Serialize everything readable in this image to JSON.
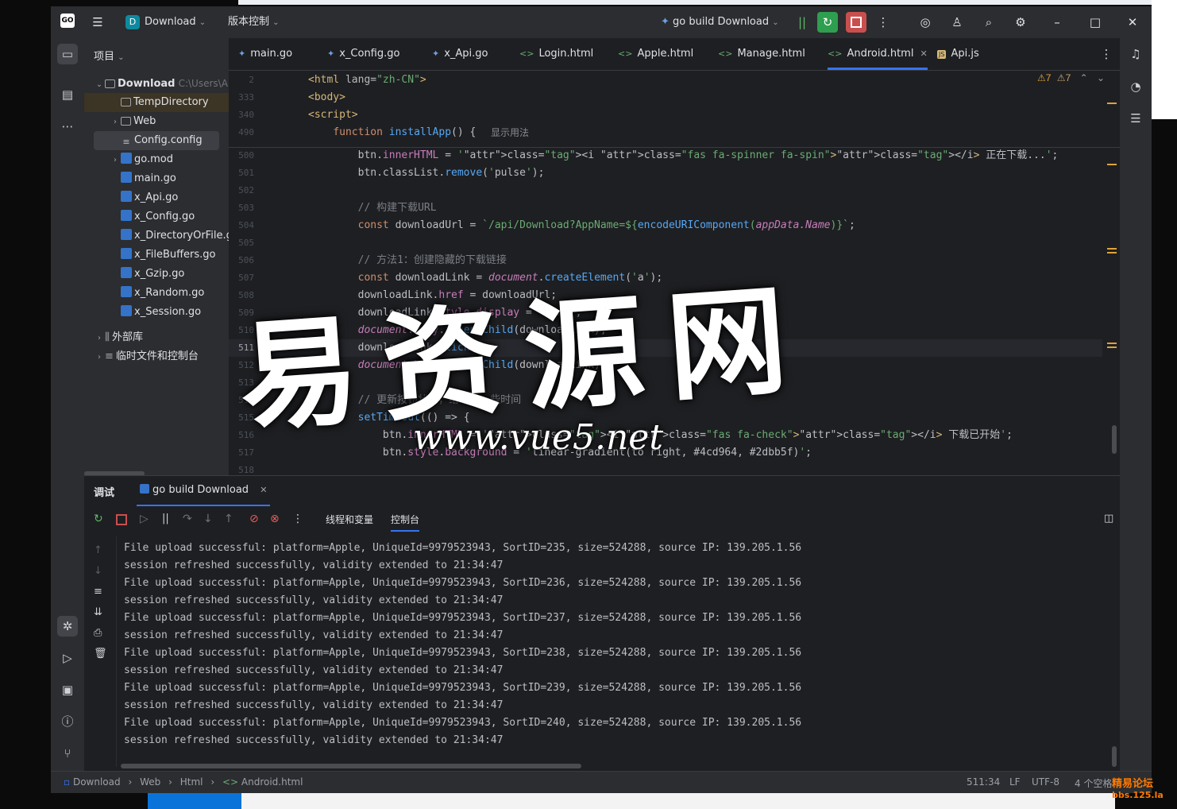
{
  "titlebar": {
    "project_badge": "D",
    "project_name": "Download",
    "vcs_label": "版本控制",
    "run_config": "go build Download"
  },
  "project_panel": {
    "header": "项目",
    "root_name": "Download",
    "root_path": "C:\\Users\\A",
    "items": [
      {
        "label": "TempDirectory",
        "type": "folder",
        "arrow": ""
      },
      {
        "label": "Web",
        "type": "folder",
        "arrow": "›"
      },
      {
        "label": "Config.config",
        "type": "cfg",
        "arrow": ""
      },
      {
        "label": "go.mod",
        "type": "go",
        "arrow": "›"
      },
      {
        "label": "main.go",
        "type": "go",
        "arrow": ""
      },
      {
        "label": "x_Api.go",
        "type": "go",
        "arrow": ""
      },
      {
        "label": "x_Config.go",
        "type": "go",
        "arrow": ""
      },
      {
        "label": "x_DirectoryOrFile.go",
        "type": "go",
        "arrow": ""
      },
      {
        "label": "x_FileBuffers.go",
        "type": "go",
        "arrow": ""
      },
      {
        "label": "x_Gzip.go",
        "type": "go",
        "arrow": ""
      },
      {
        "label": "x_Random.go",
        "type": "go",
        "arrow": ""
      },
      {
        "label": "x_Session.go",
        "type": "go",
        "arrow": ""
      }
    ],
    "external_libs": "外部库",
    "scratches": "临时文件和控制台"
  },
  "tabs": [
    {
      "label": "main.go",
      "icon": "go",
      "active": false
    },
    {
      "label": "x_Config.go",
      "icon": "go",
      "active": false
    },
    {
      "label": "x_Api.go",
      "icon": "go",
      "active": false
    },
    {
      "label": "Login.html",
      "icon": "html",
      "active": false
    },
    {
      "label": "Apple.html",
      "icon": "html",
      "active": false
    },
    {
      "label": "Manage.html",
      "icon": "html",
      "active": false
    },
    {
      "label": "Android.html",
      "icon": "html",
      "active": true
    },
    {
      "label": "Api.js",
      "icon": "js",
      "active": false
    }
  ],
  "editor": {
    "inspections": {
      "warnings_a": "7",
      "warnings_b": "7"
    },
    "sticky": [
      {
        "ln": "2",
        "code": "<html lang=\"zh-CN\">"
      },
      {
        "ln": "333",
        "code": "<body>"
      },
      {
        "ln": "340",
        "code": "<script>"
      },
      {
        "ln": "490",
        "code": "    function installApp() {",
        "hint": "显示用法"
      }
    ],
    "lines": [
      {
        "ln": "500",
        "code": "        btn.innerHTML = '<i class=\"fas fa-spinner fa-spin\"></i> 正在下载...';"
      },
      {
        "ln": "501",
        "code": "        btn.classList.remove('pulse');"
      },
      {
        "ln": "502",
        "code": ""
      },
      {
        "ln": "503",
        "code": "        // 构建下载URL"
      },
      {
        "ln": "504",
        "code": "        const downloadUrl = `/api/Download?AppName=${encodeURIComponent(appData.Name)}`;"
      },
      {
        "ln": "505",
        "code": ""
      },
      {
        "ln": "506",
        "code": "        // 方法1：创建隐藏的下载链接"
      },
      {
        "ln": "507",
        "code": "        const downloadLink = document.createElement('a');"
      },
      {
        "ln": "508",
        "code": "        downloadLink.href = downloadUrl;"
      },
      {
        "ln": "509",
        "code": "        downloadLink.style.display = 'none';"
      },
      {
        "ln": "510",
        "code": "        document.body.appendChild(downloadLink);"
      },
      {
        "ln": "511",
        "code": "        downloadLink.click();"
      },
      {
        "ln": "512",
        "code": "        document.body.removeChild(downloadLink);"
      },
      {
        "ln": "513",
        "code": ""
      },
      {
        "ln": "514",
        "code": "        // 更新按钮状态，给下载一些时间"
      },
      {
        "ln": "515",
        "code": "        setTimeout(() => {"
      },
      {
        "ln": "516",
        "code": "            btn.innerHTML = '<i class=\"fas fa-check\"></i> 下载已开始';"
      },
      {
        "ln": "517",
        "code": "            btn.style.background = 'linear-gradient(to right, #4cd964, #2dbb5f)';"
      },
      {
        "ln": "518",
        "code": ""
      }
    ]
  },
  "debug": {
    "title": "调试",
    "session_tab": "go build Download",
    "subtab_threads": "线程和变量",
    "subtab_console": "控制台",
    "console": [
      "File upload successful: platform=Apple, UniqueId=9979523943, SortID=235, size=524288, source IP: 139.205.1.56",
      "session refreshed successfully, validity extended to 21:34:47",
      "File upload successful: platform=Apple, UniqueId=9979523943, SortID=236, size=524288, source IP: 139.205.1.56",
      "session refreshed successfully, validity extended to 21:34:47",
      "File upload successful: platform=Apple, UniqueId=9979523943, SortID=237, size=524288, source IP: 139.205.1.56",
      "session refreshed successfully, validity extended to 21:34:47",
      "File upload successful: platform=Apple, UniqueId=9979523943, SortID=238, size=524288, source IP: 139.205.1.56",
      "session refreshed successfully, validity extended to 21:34:47",
      "File upload successful: platform=Apple, UniqueId=9979523943, SortID=239, size=524288, source IP: 139.205.1.56",
      "session refreshed successfully, validity extended to 21:34:47",
      "File upload successful: platform=Apple, UniqueId=9979523943, SortID=240, size=524288, source IP: 139.205.1.56",
      "session refreshed successfully, validity extended to 21:34:47"
    ]
  },
  "statusbar": {
    "breadcrumb": [
      "Download",
      "Web",
      "Html",
      "Android.html"
    ],
    "position": "511:34",
    "line_sep": "LF",
    "encoding": "UTF-8",
    "indent": "4 个空格"
  },
  "watermark": {
    "big": "易资源网",
    "url": "www.vue5.net",
    "corner_line1": "精易论坛",
    "corner_line2": "bbs.125.la"
  },
  "colors": {
    "accent": "#3574f0",
    "run_green": "#2e9e4f",
    "stop_red": "#c94f4f",
    "warning": "#e0a23a"
  }
}
